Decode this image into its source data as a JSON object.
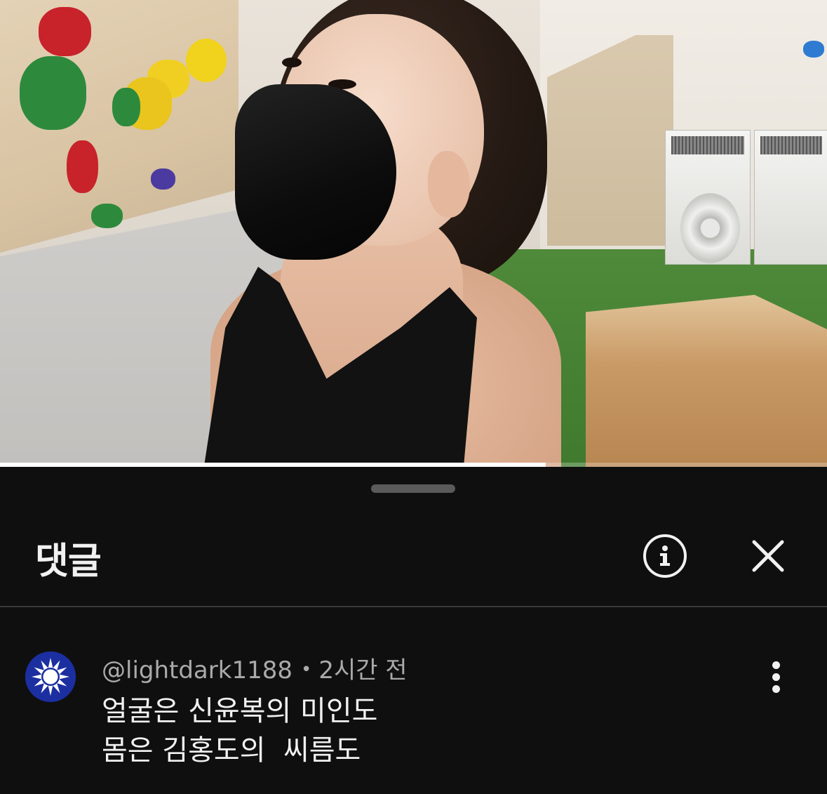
{
  "video": {
    "progress_fraction": 0.66
  },
  "comments_sheet": {
    "title": "댓글",
    "info_icon": "info-icon",
    "close_icon": "close-icon"
  },
  "comment": {
    "author": "@lightdark1188",
    "separator": "•",
    "time": "2시간 전",
    "text": "얼굴은 신윤복의 미인도\n몸은 김홍도의  씨름도",
    "avatar_icon": "white-sun-emblem-icon",
    "menu_icon": "more-vert-icon"
  },
  "colors": {
    "background": "#0f0f0f",
    "text": "#f1f1f1",
    "meta_text": "#aaaaaa",
    "avatar_blue": "#1b2fa0"
  }
}
